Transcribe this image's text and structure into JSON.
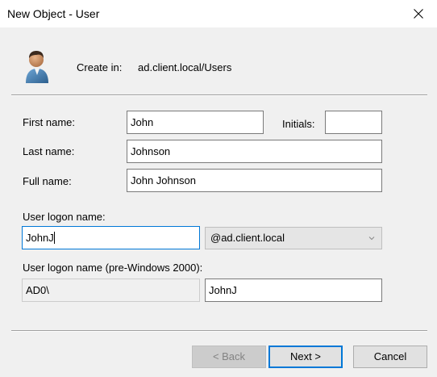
{
  "window": {
    "title": "New Object - User",
    "close_icon": "close-icon"
  },
  "header": {
    "icon": "user-icon",
    "create_in_label": "Create in:",
    "create_in_value": "ad.client.local/Users"
  },
  "form": {
    "first_name_label": "First name:",
    "first_name_value": "John",
    "initials_label": "Initials:",
    "initials_value": "",
    "last_name_label": "Last name:",
    "last_name_value": "Johnson",
    "full_name_label": "Full name:",
    "full_name_value": "John Johnson",
    "logon_name_label": "User logon name:",
    "logon_name_value": "JohnJ",
    "domain_suffix_value": "@ad.client.local",
    "pre2000_label": "User logon name (pre-Windows 2000):",
    "pre2000_domain_value": "AD0\\",
    "pre2000_name_value": "JohnJ"
  },
  "buttons": {
    "back_label": "< Back",
    "next_label": "Next >",
    "cancel_label": "Cancel"
  },
  "colors": {
    "background": "#f0f0f0",
    "focus_accent": "#0078d7"
  }
}
